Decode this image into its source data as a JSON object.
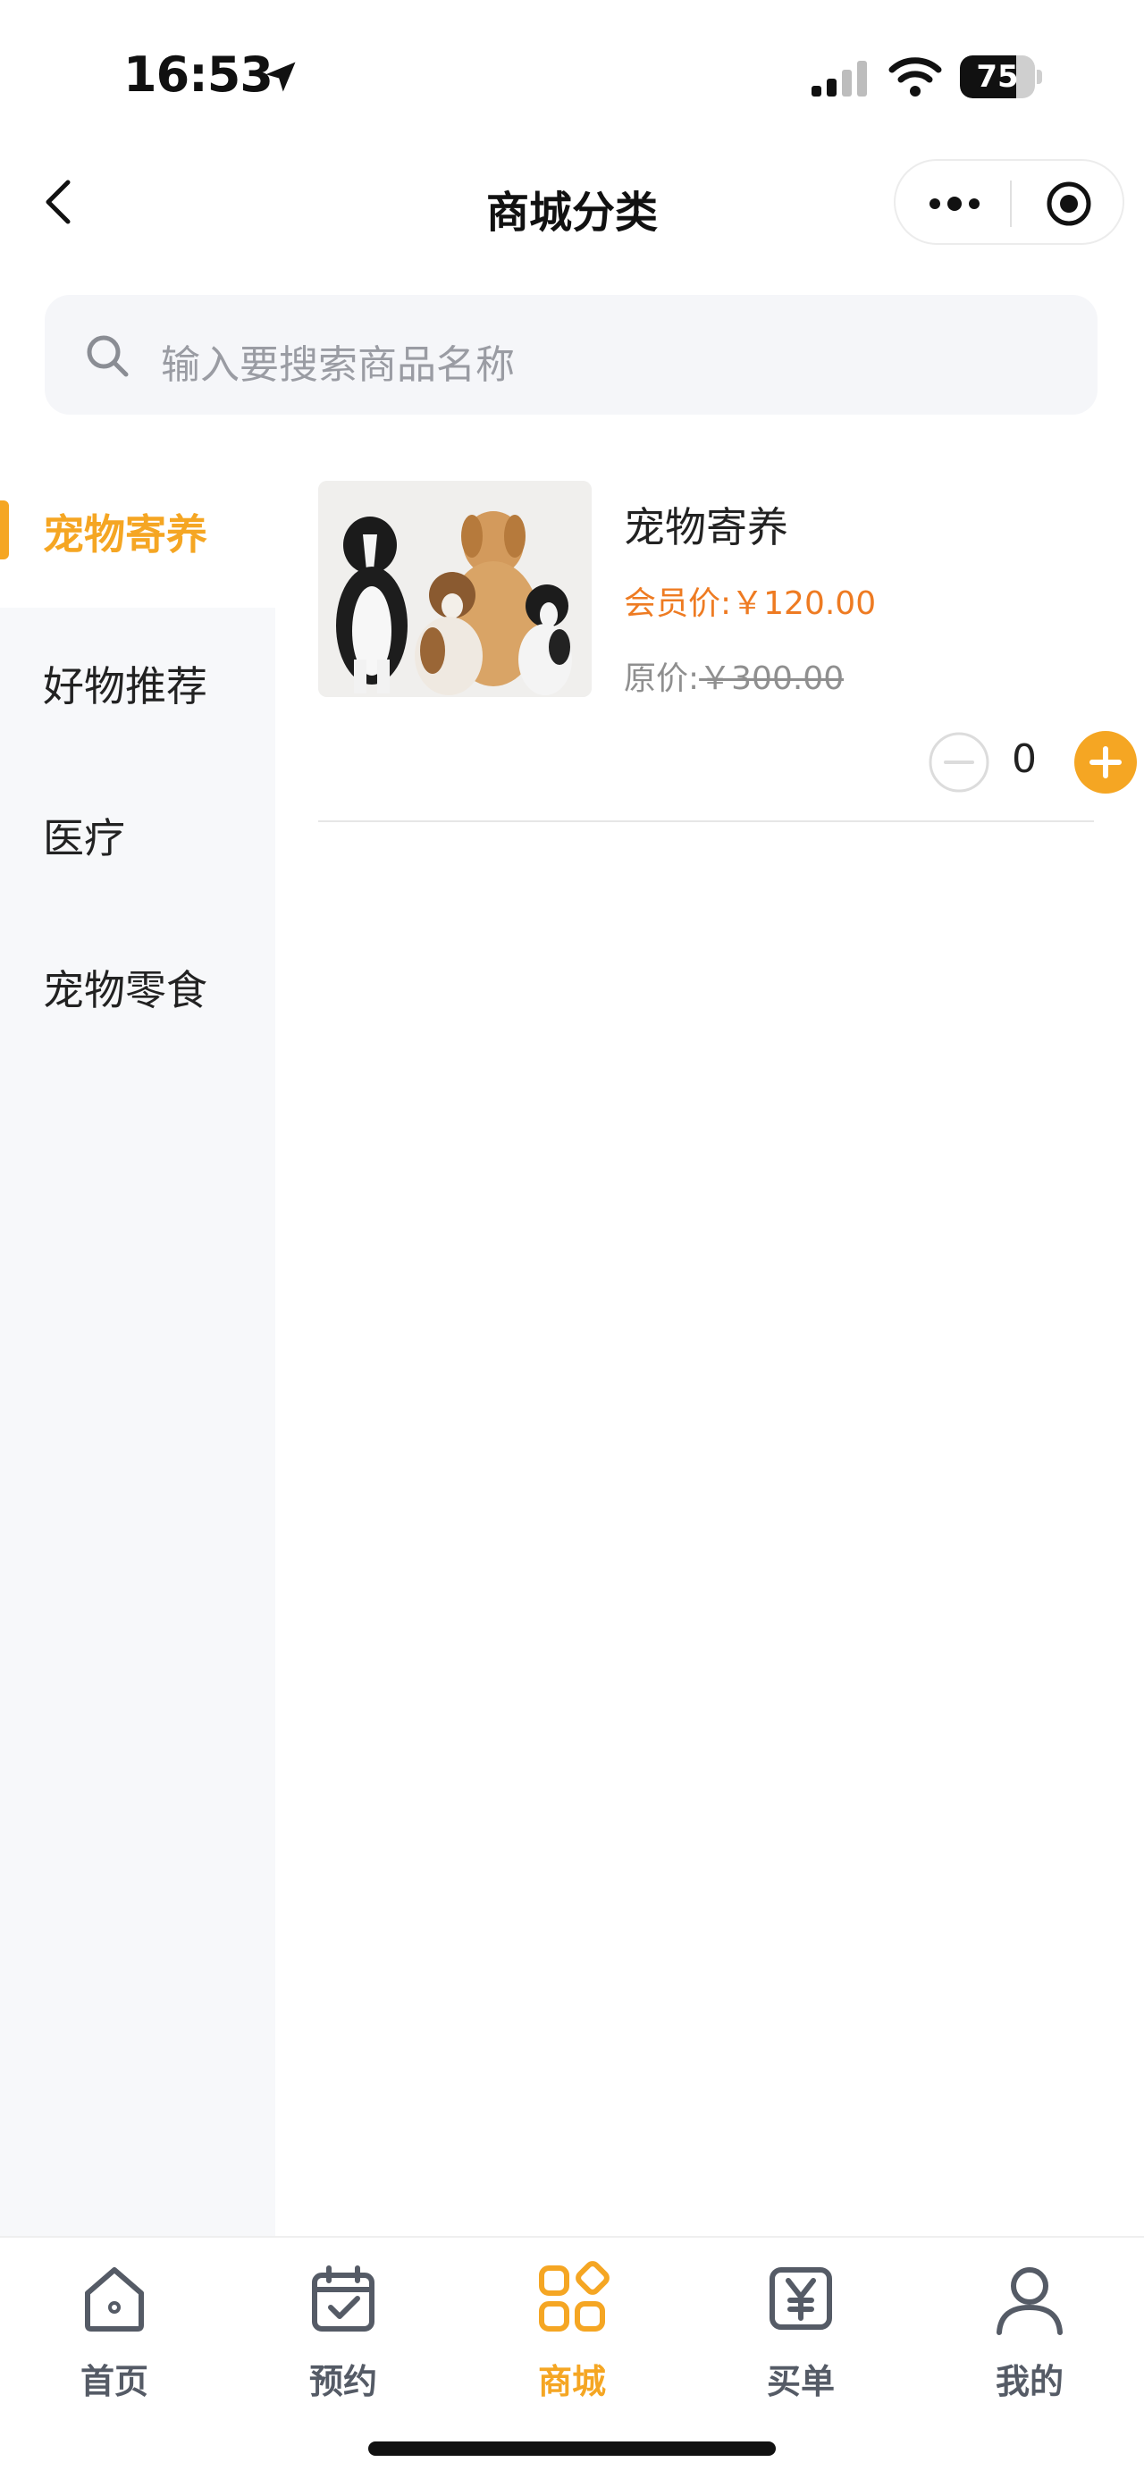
{
  "status_bar": {
    "time": "16:53",
    "battery": "75",
    "battery_level": 0.75
  },
  "nav": {
    "title": "商城分类"
  },
  "search": {
    "placeholder": "输入要搜索商品名称"
  },
  "sidebar": {
    "items": [
      {
        "label": "宠物寄养",
        "active": true
      },
      {
        "label": "好物推荐",
        "active": false
      },
      {
        "label": "医疗",
        "active": false
      },
      {
        "label": "宠物零食",
        "active": false
      }
    ]
  },
  "product": {
    "name": "宠物寄养",
    "member_label": "会员价:",
    "member_price": "￥120.00",
    "orig_label": "原价:",
    "orig_price": "￥300.00",
    "quantity": "0"
  },
  "tabbar": {
    "items": [
      {
        "label": "首页",
        "icon": "home-icon"
      },
      {
        "label": "预约",
        "icon": "calendar-check-icon"
      },
      {
        "label": "商城",
        "icon": "grid-icon",
        "active": true
      },
      {
        "label": "买单",
        "icon": "yen-icon"
      },
      {
        "label": "我的",
        "icon": "user-icon"
      }
    ]
  },
  "colors": {
    "accent": "#f5a623",
    "price": "#ee7b22",
    "sidebar_bg": "#f7f8fa",
    "search_bg": "#f5f6f9"
  }
}
